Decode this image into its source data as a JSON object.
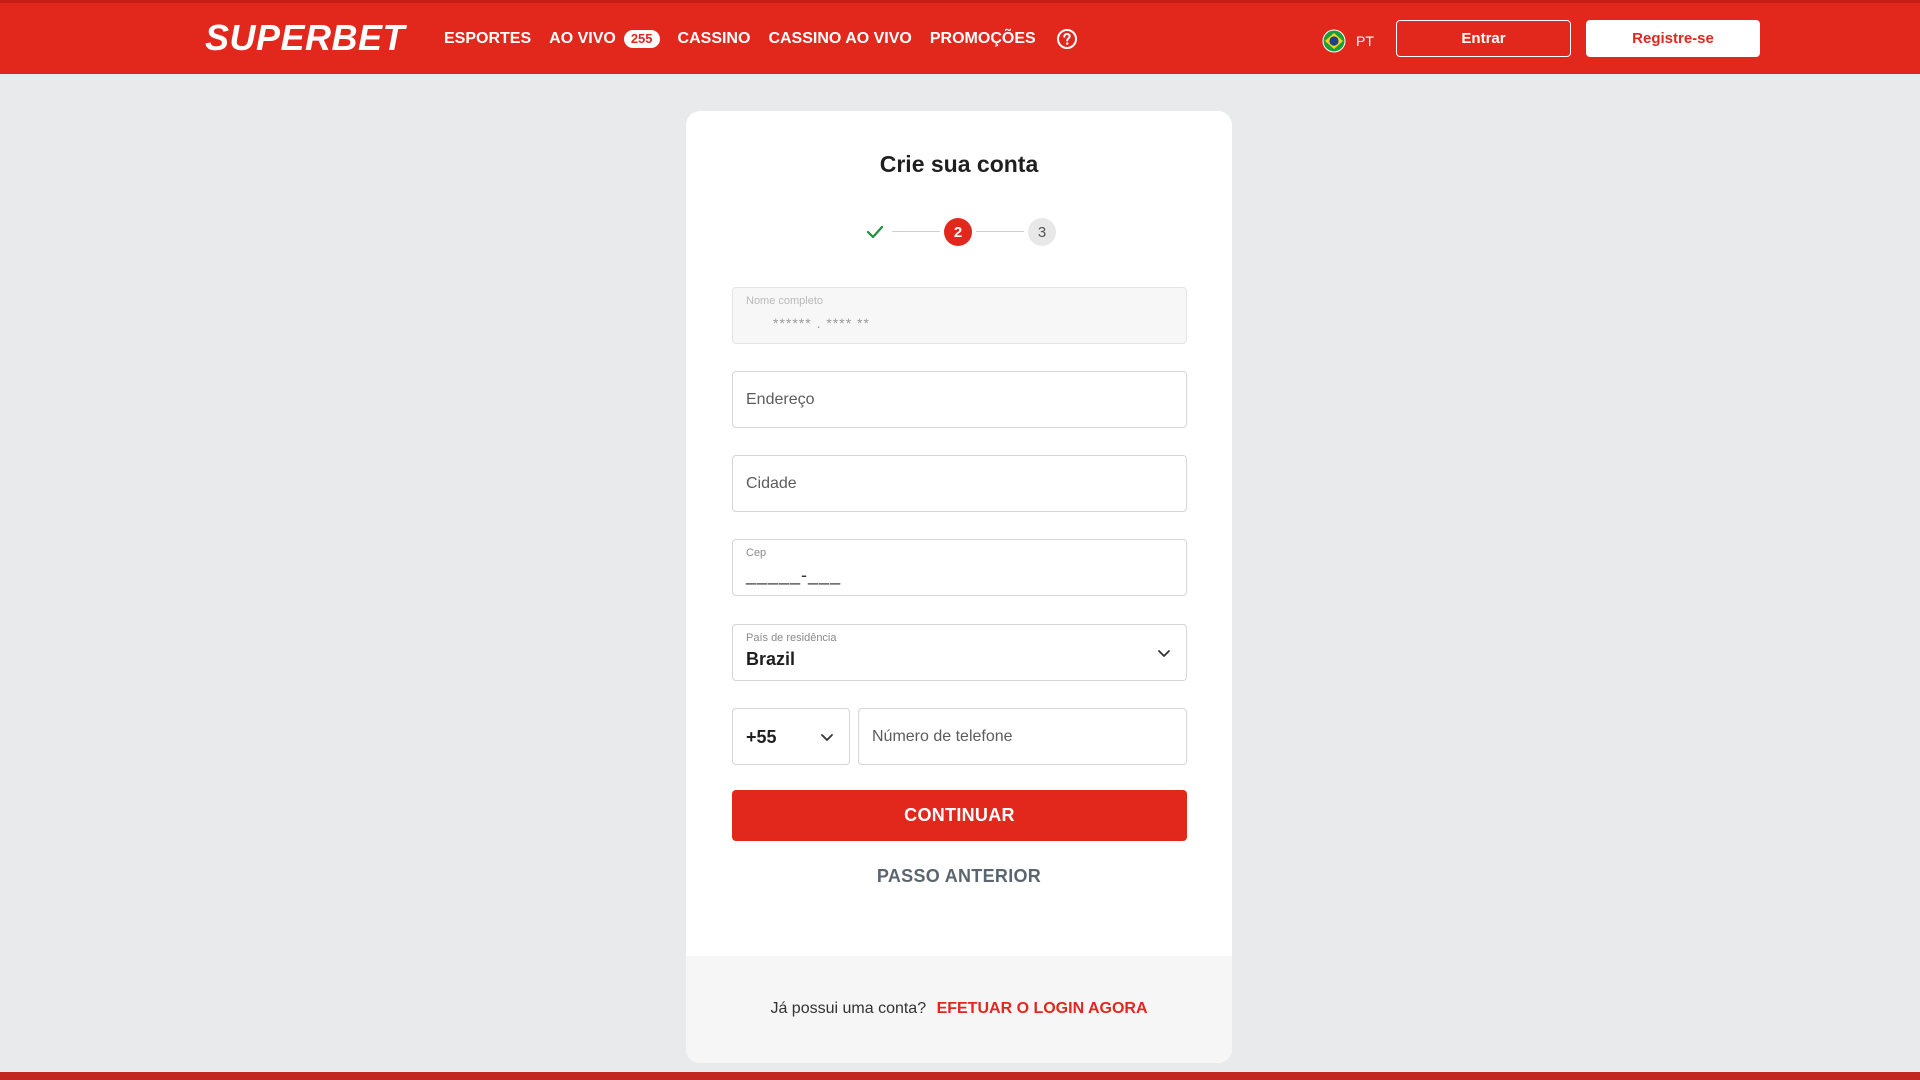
{
  "brand": {
    "logo_text": "SUPERBET",
    "accent_color": "#e2271c"
  },
  "nav": {
    "items": [
      {
        "label": "ESPORTES"
      },
      {
        "label": "AO VIVO",
        "badge": "255"
      },
      {
        "label": "CASSINO"
      },
      {
        "label": "CASSINO AO VIVO"
      },
      {
        "label": "PROMOÇÕES"
      }
    ],
    "help_icon": "question-circle-icon"
  },
  "header": {
    "language": "PT",
    "flag_icon": "brazil-flag-icon",
    "login_label": "Entrar",
    "register_label": "Registre-se"
  },
  "form": {
    "title": "Crie sua conta",
    "steps": {
      "completed_icon": "check-icon",
      "current": "2",
      "next": "3"
    },
    "full_name": {
      "label": "Nome completo",
      "value": "****** . ****   **"
    },
    "address": {
      "placeholder": "Endereço"
    },
    "city": {
      "placeholder": "Cidade"
    },
    "cep": {
      "label": "Cep",
      "mask": "_____-___"
    },
    "country": {
      "label": "País de residência",
      "value": "Brazil"
    },
    "phone": {
      "code": "+55",
      "placeholder": "Número de telefone"
    },
    "continue_label": "CONTINUAR",
    "back_label": "PASSO ANTERIOR"
  },
  "footer": {
    "question": "Já possui uma conta?",
    "login_link": "EFETUAR O LOGIN AGORA"
  }
}
